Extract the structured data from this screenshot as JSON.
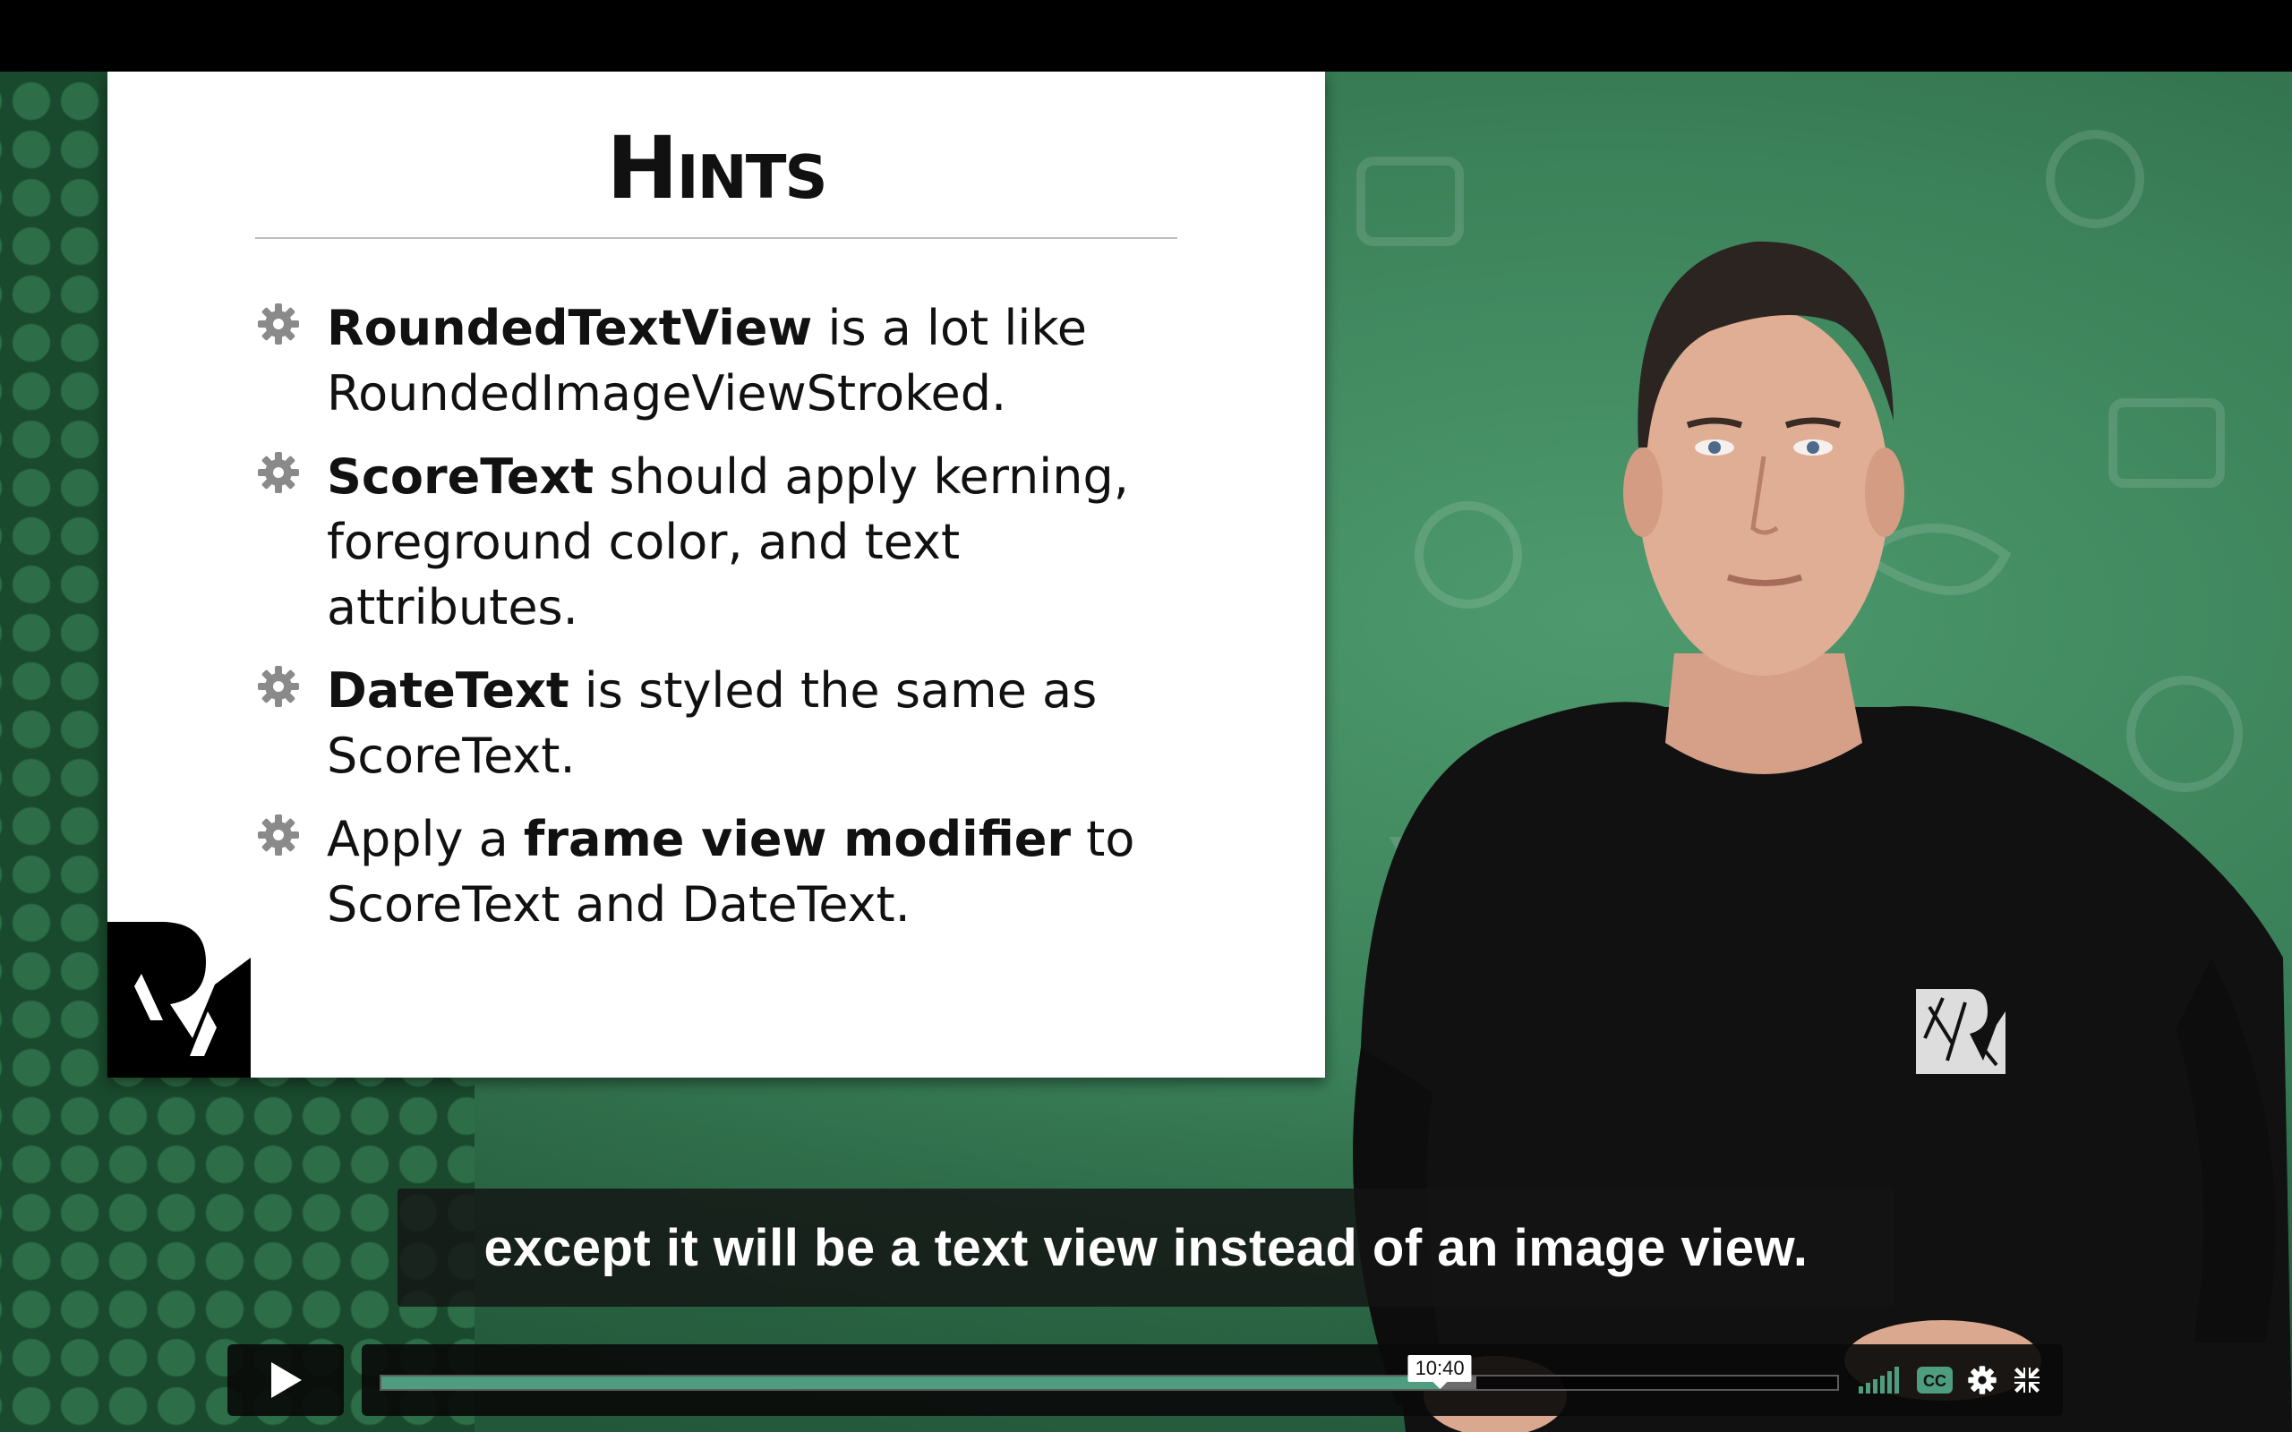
{
  "slide": {
    "title": "Hints",
    "bullets": [
      {
        "bold": "RoundedTextView",
        "rest": " is a lot like RoundedImageViewStroked."
      },
      {
        "bold": "ScoreText",
        "rest": " should apply kerning, foreground color, and text attributes."
      },
      {
        "bold": "DateText",
        "rest": " is styled the same as ScoreText."
      },
      {
        "pre": "Apply a ",
        "bold": "frame view modifier",
        "rest": " to ScoreText and DateText."
      }
    ],
    "logo_icon": "rw-logo-icon",
    "bullet_icon": "gear-icon"
  },
  "caption": {
    "text": "except it will be a text view instead of an image view."
  },
  "player": {
    "play_icon": "play-icon",
    "hover_time": "10:40",
    "progress_fraction": 0.727,
    "buffered_fraction": 0.752,
    "icons": [
      "volume-icon",
      "cc-icon",
      "settings-icon",
      "fullscreen-exit-icon"
    ],
    "accent_color": "#4e9d80"
  }
}
